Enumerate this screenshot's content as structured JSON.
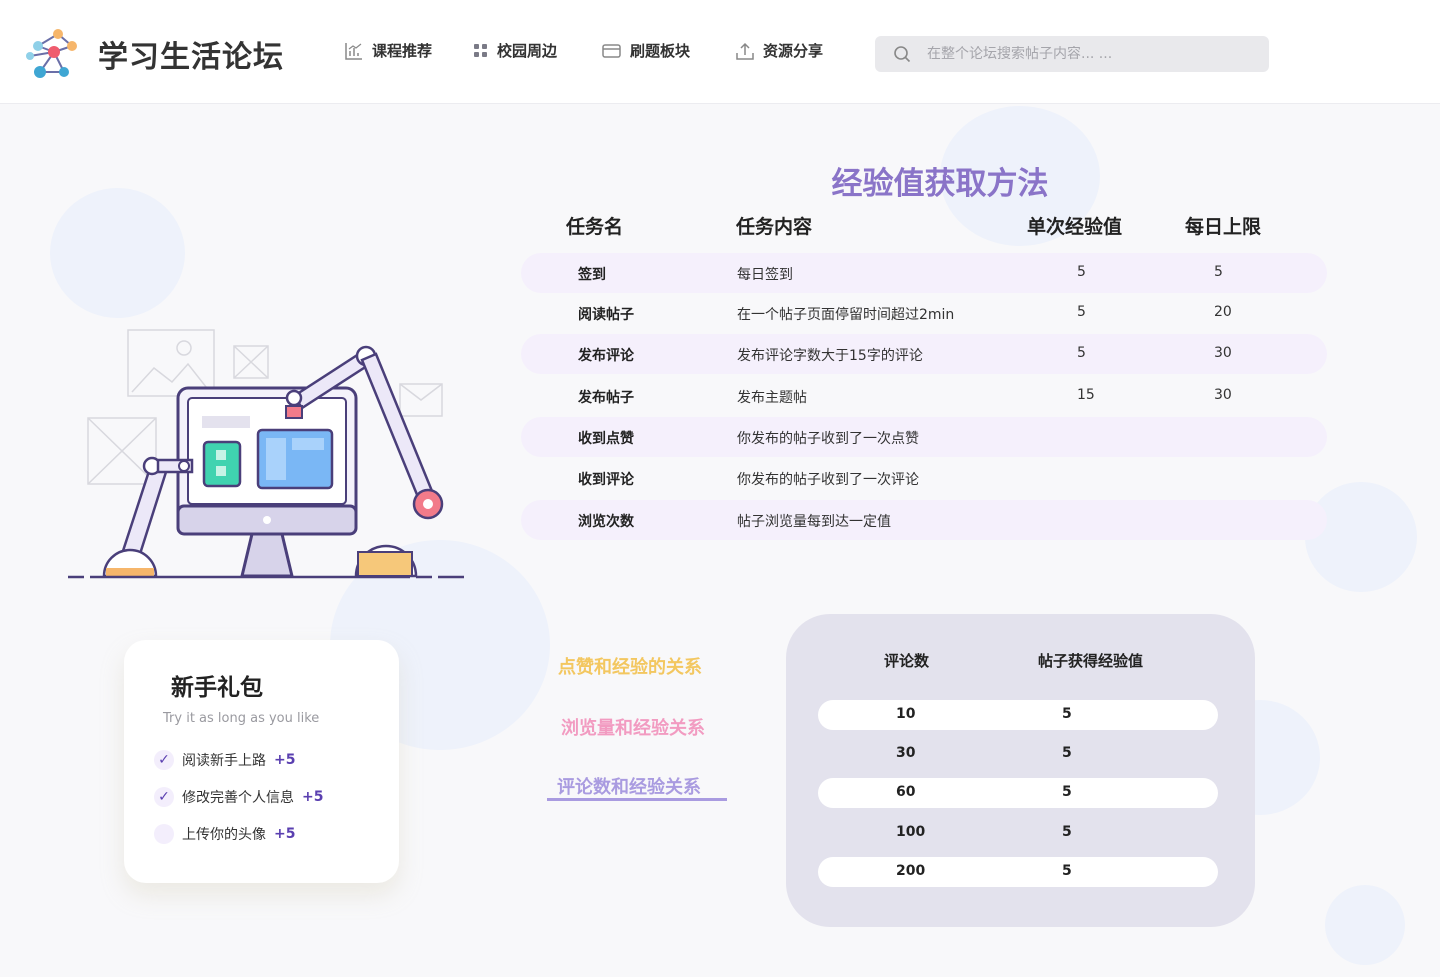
{
  "header": {
    "title": "学习生活论坛",
    "nav": [
      {
        "label": "课程推荐",
        "icon": "chart-icon"
      },
      {
        "label": "校园周边",
        "icon": "grid-icon"
      },
      {
        "label": "刷题板块",
        "icon": "card-icon"
      },
      {
        "label": "资源分享",
        "icon": "upload-icon"
      }
    ],
    "search_placeholder": "在整个论坛搜索帖子内容... ..."
  },
  "exp": {
    "title": "经验值获取方法",
    "headers": [
      "任务名",
      "任务内容",
      "单次经验值",
      "每日上限"
    ],
    "rows": [
      {
        "name": "签到",
        "content": "每日签到",
        "single": "5",
        "limit": "5"
      },
      {
        "name": "阅读帖子",
        "content": "在一个帖子页面停留时间超过2min",
        "single": "5",
        "limit": "20"
      },
      {
        "name": "发布评论",
        "content": "发布评论字数大于15字的评论",
        "single": "5",
        "limit": "30"
      },
      {
        "name": "发布帖子",
        "content": "发布主题帖",
        "single": "15",
        "limit": "30"
      },
      {
        "name": "收到点赞",
        "content": "你发布的帖子收到了一次点赞",
        "single": "",
        "limit": ""
      },
      {
        "name": "收到评论",
        "content": "你发布的帖子收到了一次评论",
        "single": "",
        "limit": ""
      },
      {
        "name": "浏览次数",
        "content": "帖子浏览量每到达一定值",
        "single": "",
        "limit": ""
      }
    ]
  },
  "gift": {
    "title": "新手礼包",
    "subtitle": "Try it as long as you like",
    "items": [
      {
        "text": "阅读新手上路",
        "bonus": "+5",
        "done": true
      },
      {
        "text": "修改完善个人信息",
        "bonus": "+5",
        "done": true
      },
      {
        "text": "上传你的头像",
        "bonus": "+5",
        "done": false
      }
    ]
  },
  "relations": {
    "like": "点赞和经验的关系",
    "view": "浏览量和经验关系",
    "comment": "评论数和经验关系",
    "active": "comment"
  },
  "comment_table": {
    "headers": [
      "评论数",
      "帖子获得经验值"
    ],
    "rows": [
      {
        "count": "10",
        "exp": "5"
      },
      {
        "count": "30",
        "exp": "5"
      },
      {
        "count": "60",
        "exp": "5"
      },
      {
        "count": "100",
        "exp": "5"
      },
      {
        "count": "200",
        "exp": "5"
      }
    ]
  },
  "colors": {
    "accent": "#8a74c8",
    "like": "#f3c760",
    "view": "#f29bc1",
    "comment": "#a99be0",
    "check": "#5a3fb0"
  }
}
